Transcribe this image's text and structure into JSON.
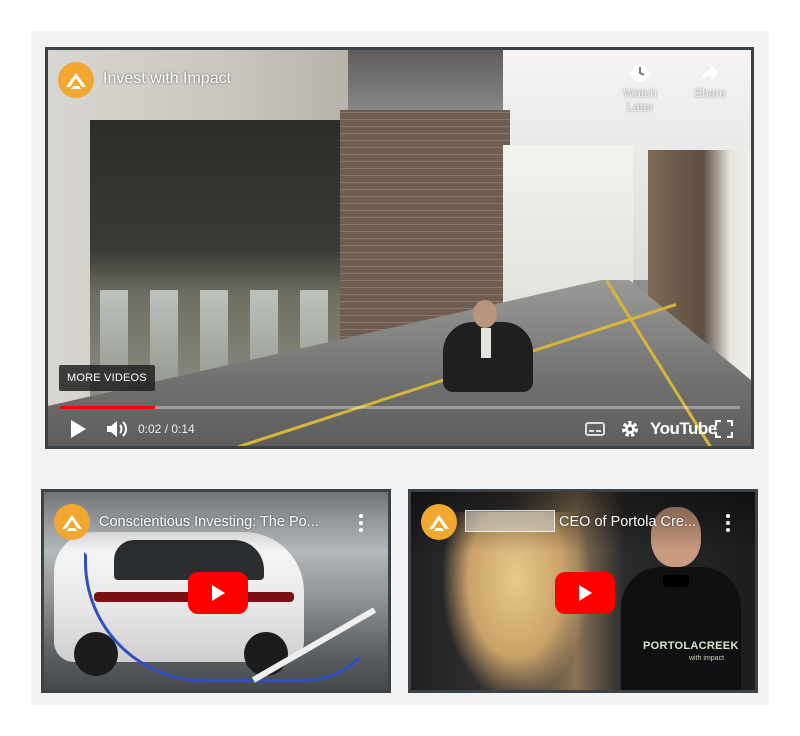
{
  "main_video": {
    "title": "Invest with Impact",
    "watch_later_label": "Watch Later",
    "share_label": "Share",
    "more_videos_label": "MORE VIDEOS",
    "current_time": "0:02",
    "duration": "0:14",
    "time_display": "0:02 / 0:14",
    "progress_fraction": 0.14,
    "youtube_label": "YouTube"
  },
  "thumbnails": [
    {
      "title": "Conscientious Investing: The Po..."
    },
    {
      "title": "CEO of Portola Cre...",
      "brand_text": "PORTOLACREEK",
      "brand_sub": "with impact"
    }
  ],
  "colors": {
    "accent_red": "#ff0000",
    "channel_logo": "#f0a830",
    "frame_border": "#3b4349",
    "panel_bg": "#f3f3f3"
  },
  "icons": [
    "channel-logo-icon",
    "clock-icon",
    "share-arrow-icon",
    "play-icon",
    "volume-icon",
    "subtitles-icon",
    "gear-icon",
    "fullscreen-icon",
    "kebab-menu-icon",
    "youtube-play-icon"
  ]
}
